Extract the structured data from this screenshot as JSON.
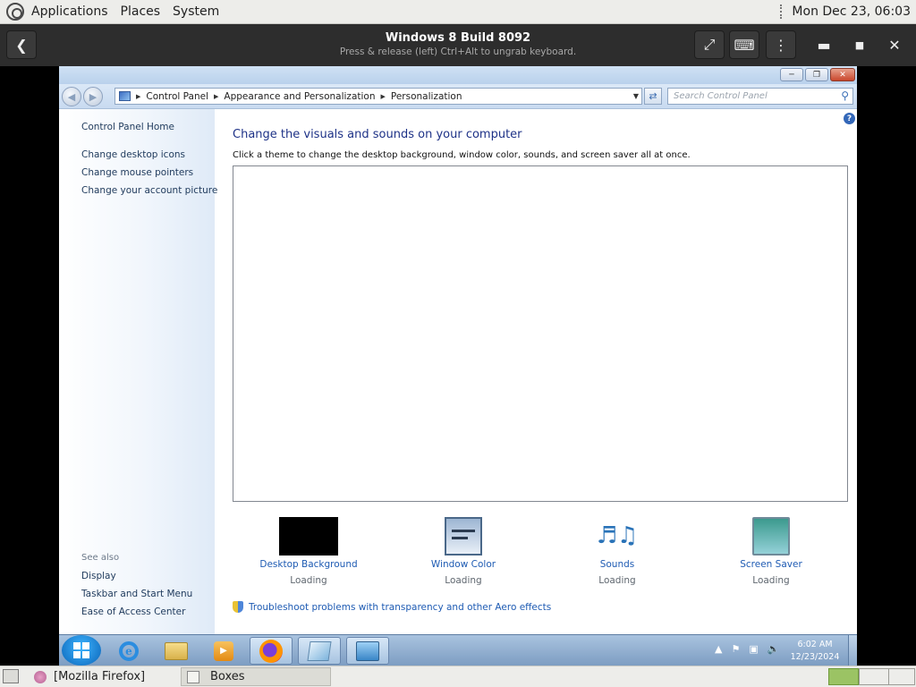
{
  "host_top_panel": {
    "menus": [
      "Applications",
      "Places",
      "System"
    ],
    "clock": "Mon Dec 23, 06:03"
  },
  "boxes_header": {
    "title": "Windows 8 Build 8092",
    "subtitle": "Press & release (left) Ctrl+Alt to ungrab keyboard.",
    "icons": {
      "back": "back-arrow-icon",
      "fullscreen": "fullscreen-icon",
      "keyboard": "keyboard-icon",
      "menu": "menu-dots-icon",
      "minimize": "minimize-icon",
      "maximize": "maximize-icon",
      "close": "close-icon"
    }
  },
  "explorer": {
    "breadcrumb": [
      "Control Panel",
      "Appearance and Personalization",
      "Personalization"
    ],
    "search_placeholder": "Search Control Panel"
  },
  "left_pane": {
    "home_link": "Control Panel Home",
    "tasks": [
      "Change desktop icons",
      "Change mouse pointers",
      "Change your account picture"
    ],
    "see_also_label": "See also",
    "see_also": [
      "Display",
      "Taskbar and Start Menu",
      "Ease of Access Center"
    ]
  },
  "main": {
    "title": "Change the visuals and sounds on your computer",
    "subtitle": "Click a theme to change the desktop background, window color, sounds, and screen saver all at once.",
    "tiles": [
      {
        "label": "Desktop Background",
        "status": "Loading"
      },
      {
        "label": "Window Color",
        "status": "Loading"
      },
      {
        "label": "Sounds",
        "status": "Loading"
      },
      {
        "label": "Screen Saver",
        "status": "Loading"
      }
    ],
    "troubleshoot_link": "Troubleshoot problems with transparency and other Aero effects"
  },
  "guest_taskbar": {
    "time": "6:02 AM",
    "date": "12/23/2024"
  },
  "host_bottom_panel": {
    "tasks": [
      "[Mozilla Firefox]",
      "Boxes"
    ]
  },
  "colors": {
    "link": "#1e5bb3",
    "title": "#1e3287",
    "boxes_header_bg": "#2d2d2d",
    "panel_bg": "#ededea"
  }
}
